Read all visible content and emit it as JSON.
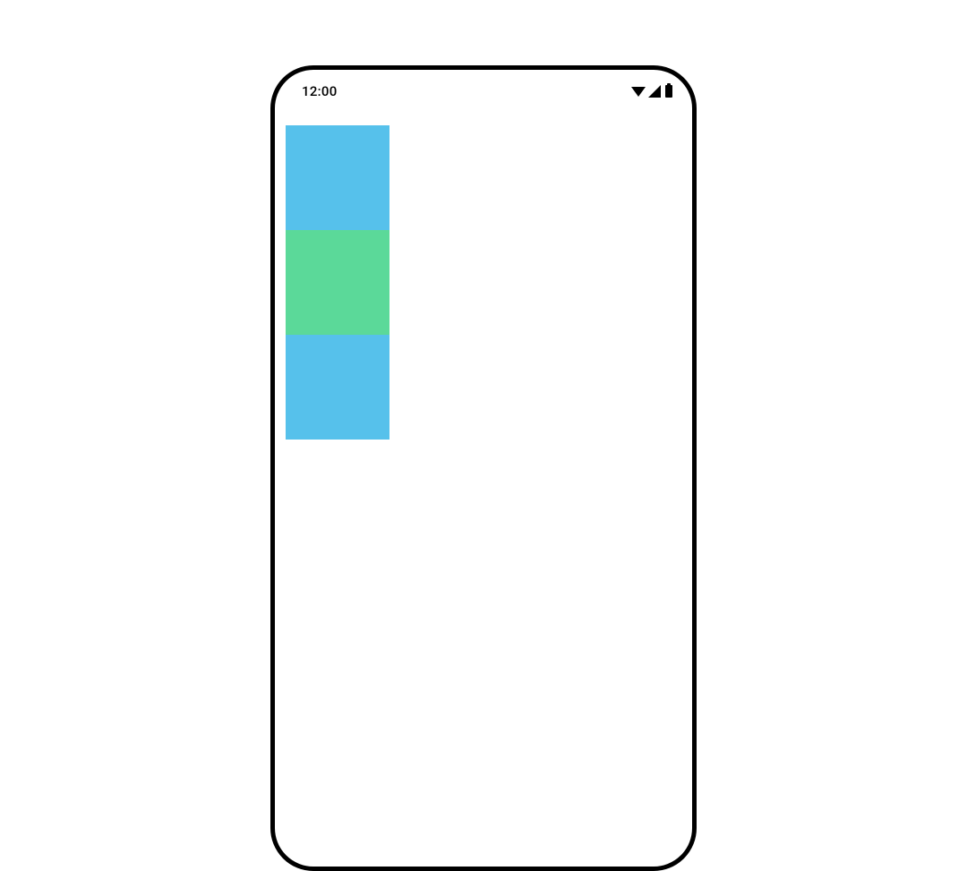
{
  "statusBar": {
    "time": "12:00"
  },
  "blocks": {
    "top": {
      "color": "#56c1eb"
    },
    "middle": {
      "color": "#5bd999"
    },
    "bottom": {
      "color": "#56c1eb"
    }
  }
}
